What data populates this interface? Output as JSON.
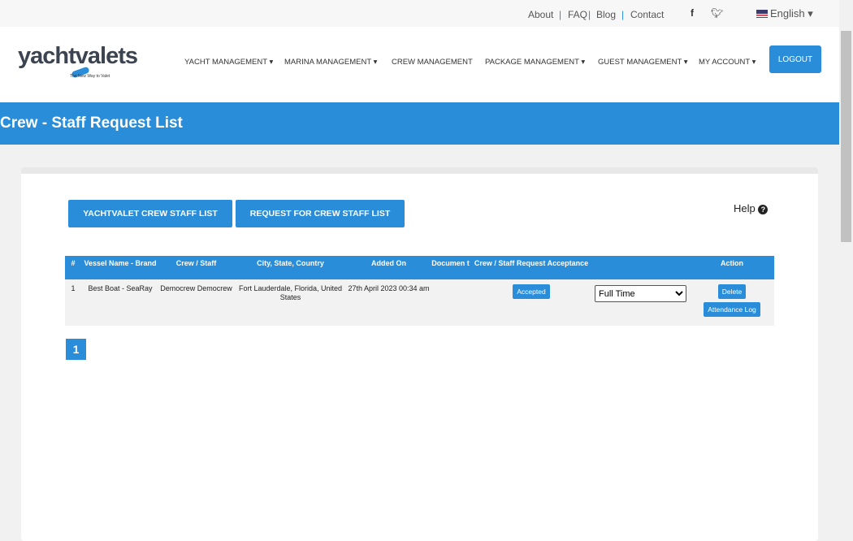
{
  "topbar": {
    "links": [
      "About",
      "FAQ",
      "Blog",
      "Contact"
    ],
    "language": "English"
  },
  "header": {
    "logo": "yachtvalets",
    "tagline": "The New Way to Valet",
    "nav": [
      "YACHT MANAGEMENT",
      "MARINA MANAGEMENT",
      "CREW MANAGEMENT",
      "PACKAGE MANAGEMENT",
      "GUEST MANAGEMENT",
      "MY ACCOUNT"
    ],
    "logout": "LOGOUT"
  },
  "page": {
    "title": "Crew - Staff Request List",
    "btn1": "YACHTVALET CREW STAFF LIST",
    "btn2": "REQUEST FOR CREW STAFF LIST",
    "help": "Help"
  },
  "table": {
    "headers": [
      "#",
      "Vessel Name - Brand",
      "Crew / Staff",
      "City, State, Country",
      "Added On",
      "Documen t",
      "Crew / Staff Request Acceptance",
      "",
      "Action"
    ],
    "rows": [
      {
        "num": "1",
        "vessel": "Best Boat - SeaRay",
        "crew": "Democrew Democrew",
        "city": "Fort Lauderdale, Florida, United States",
        "added": "27th April 2023 00:34 am",
        "document": "",
        "acceptance": "Accepted",
        "type": "Full Time",
        "delete": "Delete",
        "attendance": "Attendance Log"
      }
    ]
  },
  "pagination": {
    "current": "1"
  }
}
